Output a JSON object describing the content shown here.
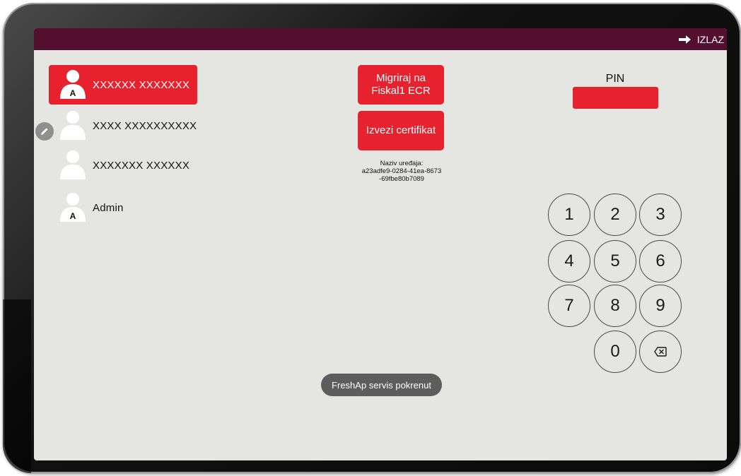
{
  "topbar": {
    "logout_label": "IZLAZ",
    "background": "#52102e"
  },
  "users": [
    {
      "name": "XXXXXX XXXXXXX",
      "badge": "A",
      "selected": true
    },
    {
      "name": "XXXX XXXXXXXXXX",
      "badge": "",
      "selected": false
    },
    {
      "name": "XXXXXXX XXXXXX",
      "badge": "",
      "selected": false
    },
    {
      "name": "Admin",
      "badge": "A",
      "selected": false
    }
  ],
  "actions": {
    "migrate_line1": "Migriraj na",
    "migrate_line2": "Fiskal1 ECR",
    "export_cert": "Izvezi certifikat"
  },
  "device": {
    "label": "Naziv uređaja:",
    "id_line1": "a23adfe9-0284-41ea-8673",
    "id_line2": "-69fbe80b7089"
  },
  "pin": {
    "label": "PIN",
    "value": ""
  },
  "keypad": {
    "k1": "1",
    "k2": "2",
    "k3": "3",
    "k4": "4",
    "k5": "5",
    "k6": "6",
    "k7": "7",
    "k8": "8",
    "k9": "9",
    "k0": "0"
  },
  "toast": {
    "message": "FreshAp servis pokrenut"
  },
  "colors": {
    "accent": "#e8212f",
    "screen_bg": "#e5e5e1",
    "toast_bg": "#5d5d5d"
  },
  "icons": {
    "logout": "arrow-right-icon",
    "user": "user-avatar-icon",
    "edit": "pencil-icon",
    "backspace": "backspace-icon"
  }
}
